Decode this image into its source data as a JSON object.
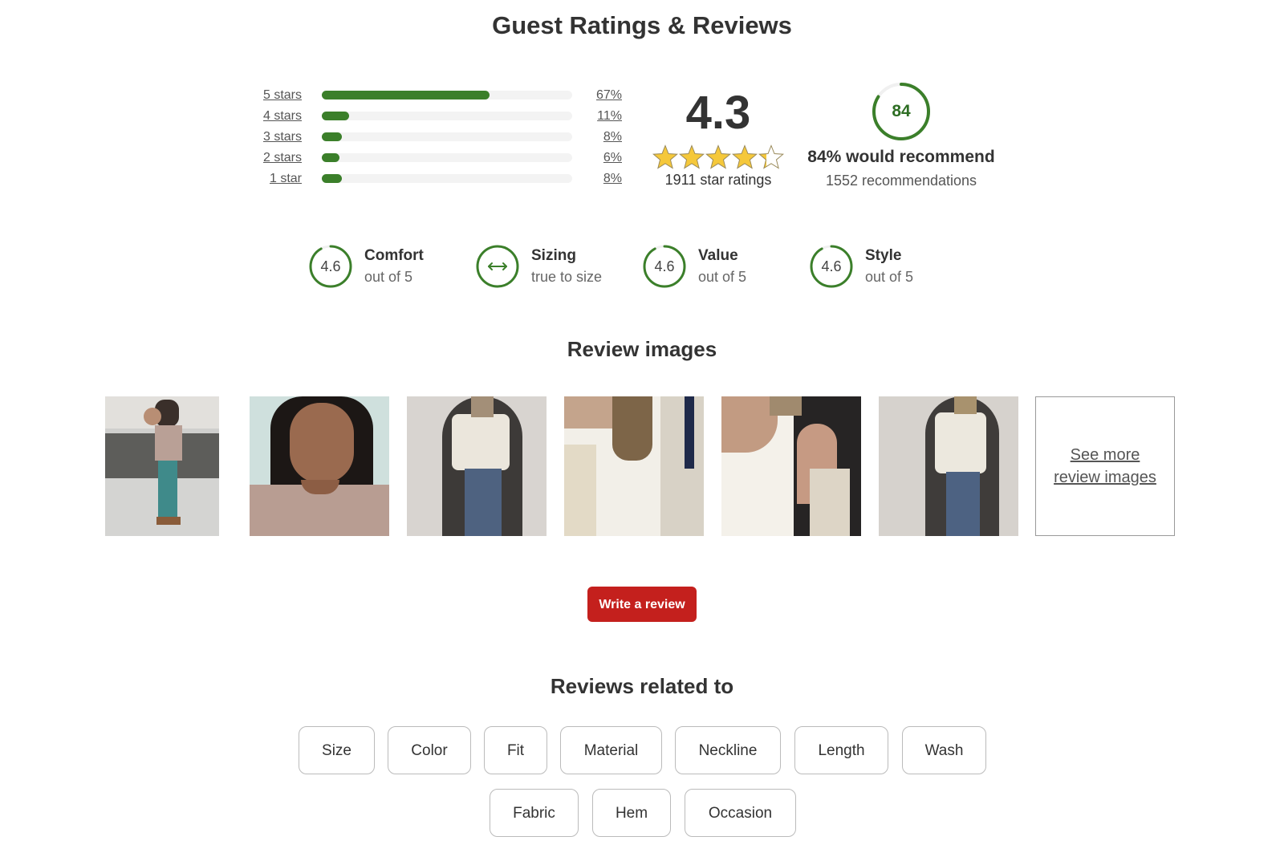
{
  "page_title": "Guest Ratings & Reviews",
  "distribution": [
    {
      "label": "5 stars",
      "percent": 67,
      "percent_label": "67%"
    },
    {
      "label": "4 stars",
      "percent": 11,
      "percent_label": "11%"
    },
    {
      "label": "3 stars",
      "percent": 8,
      "percent_label": "8%"
    },
    {
      "label": "2 stars",
      "percent": 6,
      "percent_label": "6%"
    },
    {
      "label": "1 star",
      "percent": 8,
      "percent_label": "8%"
    }
  ],
  "overall": {
    "score": "4.3",
    "stars_value": 4.3,
    "stars_max": 5,
    "count_label": "1911 star ratings"
  },
  "recommend": {
    "percent": 84,
    "ring_value": "84",
    "headline": "84% would recommend",
    "count_label": "1552 recommendations"
  },
  "attributes": [
    {
      "name": "Comfort",
      "ring": "4.6",
      "value": 4.6,
      "sub": "out of 5",
      "icon": null
    },
    {
      "name": "Sizing",
      "ring": "",
      "value": null,
      "sub": "true to size",
      "icon": "arrows-horizontal-icon"
    },
    {
      "name": "Value",
      "ring": "4.6",
      "value": 4.6,
      "sub": "out of 5",
      "icon": null
    },
    {
      "name": "Style",
      "ring": "4.6",
      "value": 4.6,
      "sub": "out of 5",
      "icon": null
    }
  ],
  "review_images": {
    "title": "Review images",
    "thumbnails": [
      {
        "alt": "woman holding baby outdoors"
      },
      {
        "alt": "selfie in tan tank top"
      },
      {
        "alt": "mirror selfie with cardigan and jeans"
      },
      {
        "alt": "close-up of white ribbed tank with cardigan"
      },
      {
        "alt": "close-up of white tank top shoulder"
      },
      {
        "alt": "mirror selfie in white tank and jeans"
      }
    ],
    "see_more_label": "See more review images"
  },
  "write_review_label": "Write a review",
  "colors": {
    "accent_green": "#3b7f2a",
    "button_red": "#c4201d",
    "star_gold": "#f5c83a"
  },
  "related": {
    "title": "Reviews related to",
    "chips": [
      "Size",
      "Color",
      "Fit",
      "Material",
      "Neckline",
      "Length",
      "Wash",
      "Fabric",
      "Hem",
      "Occasion"
    ]
  }
}
